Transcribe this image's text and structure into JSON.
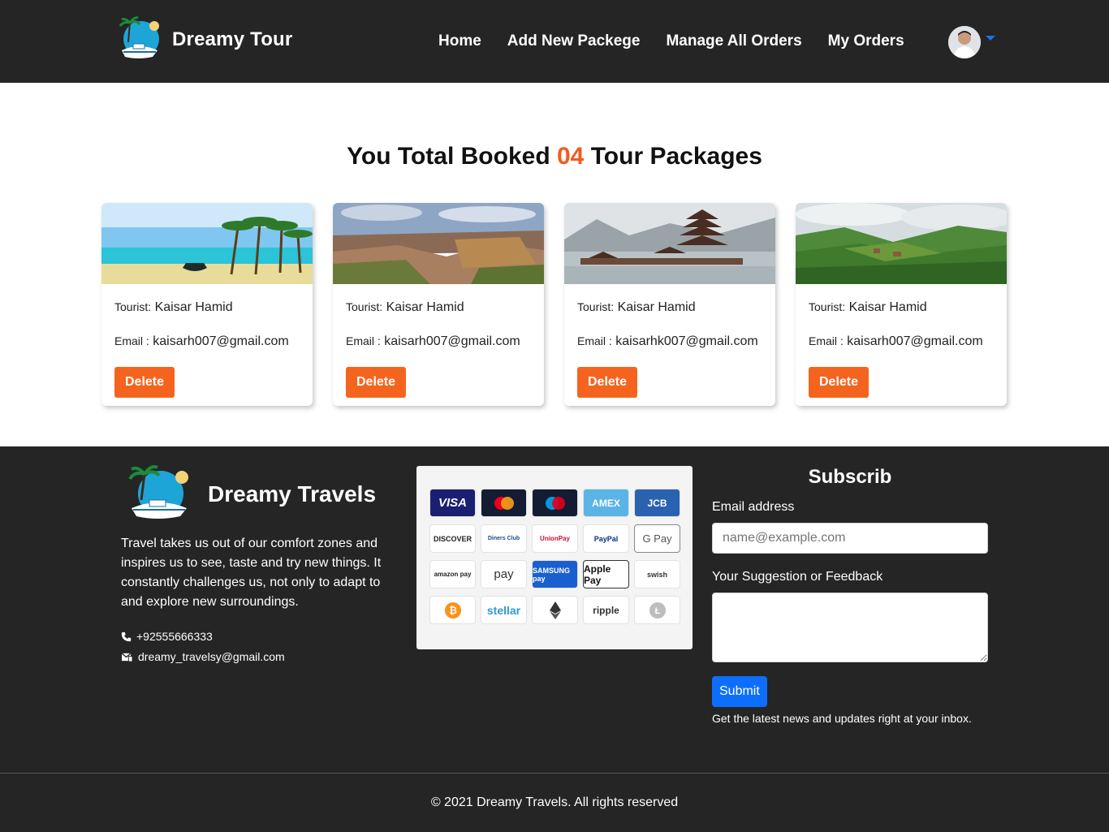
{
  "header": {
    "brand": "Dreamy Tour",
    "nav": [
      "Home",
      "Add New Packege",
      "Manage All Orders",
      "My Orders"
    ]
  },
  "main": {
    "title_prefix": "You Total Booked ",
    "title_count": "04",
    "title_suffix": " Tour Packages",
    "accent_color": "#f25c1e",
    "orders": [
      {
        "image": "beach-boat-palms",
        "tourist_label": "Tourist:",
        "tourist": "Kaisar Hamid",
        "email_label": "Email :",
        "email": "kaisarh007@gmail.com",
        "delete_label": "Delete"
      },
      {
        "image": "canyon",
        "tourist_label": "Tourist:",
        "tourist": "Kaisar Hamid",
        "email_label": "Email :",
        "email": "kaisarh007@gmail.com",
        "delete_label": "Delete"
      },
      {
        "image": "lake-temple",
        "tourist_label": "Tourist:",
        "tourist": "Kaisar Hamid",
        "email_label": "Email :",
        "email": "kaisarhk007@gmail.com",
        "delete_label": "Delete"
      },
      {
        "image": "green-hills",
        "tourist_label": "Tourist:",
        "tourist": "Kaisar Hamid",
        "email_label": "Email :",
        "email": "kaisarh007@gmail.com",
        "delete_label": "Delete"
      }
    ]
  },
  "footer": {
    "brand": "Dreamy Travels",
    "about": "Travel takes us out of our comfort zones and inspires us to see, taste and try new things. It constantly challenges us, not only to adapt to and explore new surroundings.",
    "phone": "+92555666333",
    "email": "dreamy_travelsy@gmail.com",
    "payment_methods": [
      "VISA",
      "Mastercard",
      "Maestro",
      "AMEX",
      "JCB",
      "DISCOVER",
      "Diners Club",
      "UnionPay",
      "PayPal",
      "G Pay",
      "amazon pay",
      "pay",
      "SAMSUNG pay",
      "Apple Pay",
      "swish",
      "Bitcoin",
      "stellar",
      "Ethereum",
      "ripple",
      "Litecoin"
    ],
    "subscribe": {
      "title": "Subscrib",
      "email_label": "Email address",
      "email_placeholder": "name@example.com",
      "feedback_label": "Your Suggestion or Feedback",
      "submit_label": "Submit",
      "note": "Get the latest news and updates right at your inbox."
    },
    "copyright": "© 2021 Dreamy Travels. All rights reserved"
  }
}
